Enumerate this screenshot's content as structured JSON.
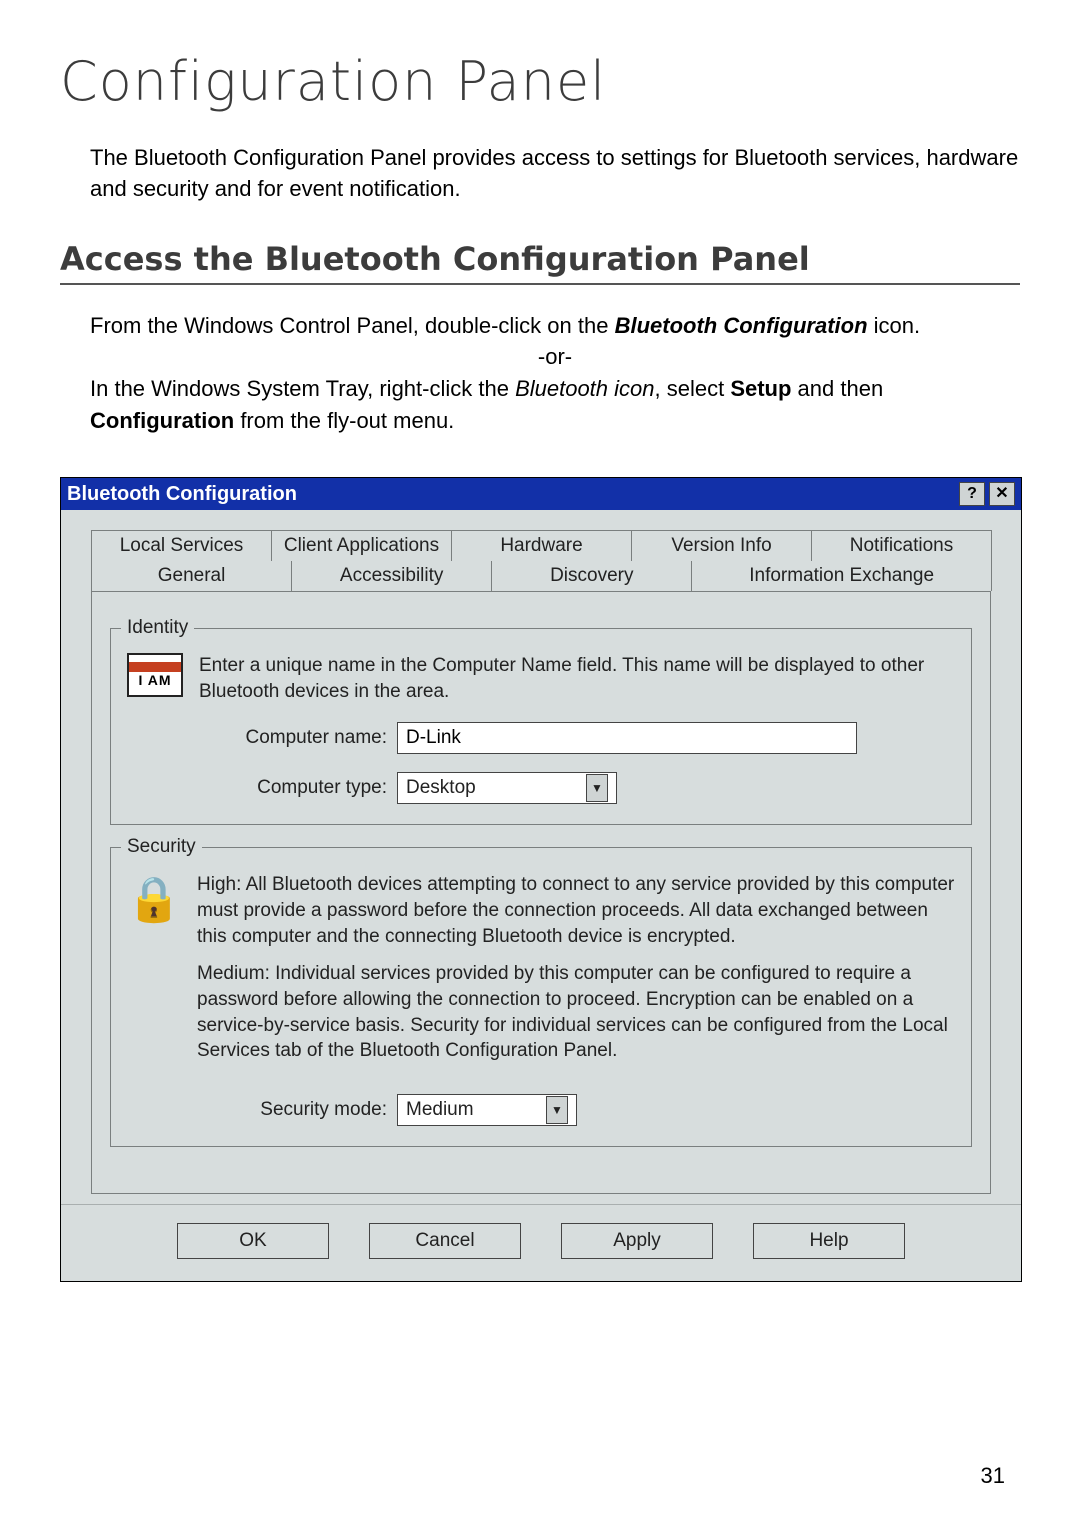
{
  "page": {
    "h1": "Configuration Panel",
    "intro": "The Bluetooth Configuration Panel provides access to settings for Bluetooth services, hardware and security and for event notification.",
    "h2": "Access the Bluetooth Configuration Panel",
    "body": {
      "line1_pre": "From the Windows Control Panel, double-click on the ",
      "line1_bold": "Bluetooth Configuration",
      "line1_post": " icon.",
      "or": "-or-",
      "line2_pre": "In the Windows System Tray, right-click the ",
      "line2_italic": "Bluetooth icon",
      "line2_mid": ", select ",
      "line2_bold": "Setup",
      "line2_mid2": " and then ",
      "line2_bold2": "Configuration",
      "line2_post": " from the fly-out menu."
    },
    "pagenum": "31"
  },
  "dialog": {
    "title": "Bluetooth Configuration",
    "help_glyph": "?",
    "close_glyph": "✕",
    "tabs_row1": [
      "Local Services",
      "Client Applications",
      "Hardware",
      "Version Info",
      "Notifications"
    ],
    "tabs_row2": [
      "General",
      "Accessibility",
      "Discovery",
      "Information Exchange"
    ],
    "identity": {
      "legend": "Identity",
      "iam_label": "I AM",
      "text": "Enter a unique name in the Computer Name field. This name will be displayed to other Bluetooth devices in the area.",
      "computer_name_label": "Computer name:",
      "computer_name_value": "D-Link",
      "computer_type_label": "Computer type:",
      "computer_type_value": "Desktop"
    },
    "security": {
      "legend": "Security",
      "high": "High: All Bluetooth devices attempting to connect to any service provided by this computer must provide a password before the connection proceeds. All data exchanged between this computer and the connecting Bluetooth device is encrypted.",
      "medium": "Medium: Individual services provided by this computer can be configured to require a password before allowing the connection to proceed. Encryption can be enabled on a service-by-service basis. Security for individual services can be configured from the Local Services tab of the Bluetooth Configuration Panel.",
      "mode_label": "Security mode:",
      "mode_value": "Medium"
    },
    "buttons": {
      "ok": "OK",
      "cancel": "Cancel",
      "apply": "Apply",
      "help": "Help"
    }
  }
}
